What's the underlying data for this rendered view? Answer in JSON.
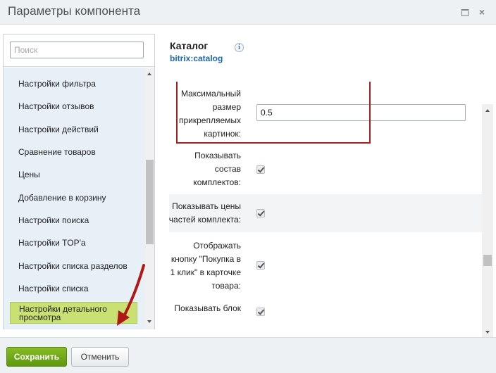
{
  "window": {
    "title": "Параметры компонента",
    "close_glyph": "×"
  },
  "sidebar": {
    "search_placeholder": "Поиск",
    "items": [
      "Настройки фильтра",
      "Настройки отзывов",
      "Настройки действий",
      "Сравнение товаров",
      "Цены",
      "Добавление в корзину",
      "Настройки поиска",
      "Настройки TOP'a",
      "Настройки списка разделов",
      "Настройки списка",
      "Настройки детального просмотра"
    ],
    "active_index": 10
  },
  "component": {
    "title": "Каталог",
    "code": "bitrix:catalog",
    "info_glyph": "i"
  },
  "properties": [
    {
      "label": "Максимальный размер прикрепляемых картинок:",
      "type": "text",
      "value": "0.5"
    },
    {
      "label": "Показывать состав комплектов:",
      "type": "checkbox",
      "checked": true
    },
    {
      "label": "Показывать цены частей комплекта:",
      "type": "checkbox",
      "checked": true
    },
    {
      "label": "Отображать кнопку \"Покупка в 1 клик\" в карточке товара:",
      "type": "checkbox",
      "checked": true
    },
    {
      "label": "Показывать блок",
      "type": "checkbox",
      "checked": true
    }
  ],
  "prop_lines": {
    "p0": [
      "Максимальный",
      "размер",
      "прикрепляемых",
      "картинок:"
    ],
    "p1": [
      "Показывать",
      "состав",
      "комплектов:"
    ],
    "p2": [
      "Показывать цены",
      "частей комплекта:"
    ],
    "p3": [
      "Отображать",
      "кнопку \"Покупка в",
      "1 клик\" в карточке",
      "товара:"
    ],
    "p4": [
      "Показывать блок"
    ]
  },
  "footer": {
    "save_label": "Сохранить",
    "cancel_label": "Отменить"
  },
  "colors": {
    "active_item": "#c9e073",
    "save_button": "#6ea718",
    "highlight_border": "#a32020",
    "link": "#2067b0"
  }
}
